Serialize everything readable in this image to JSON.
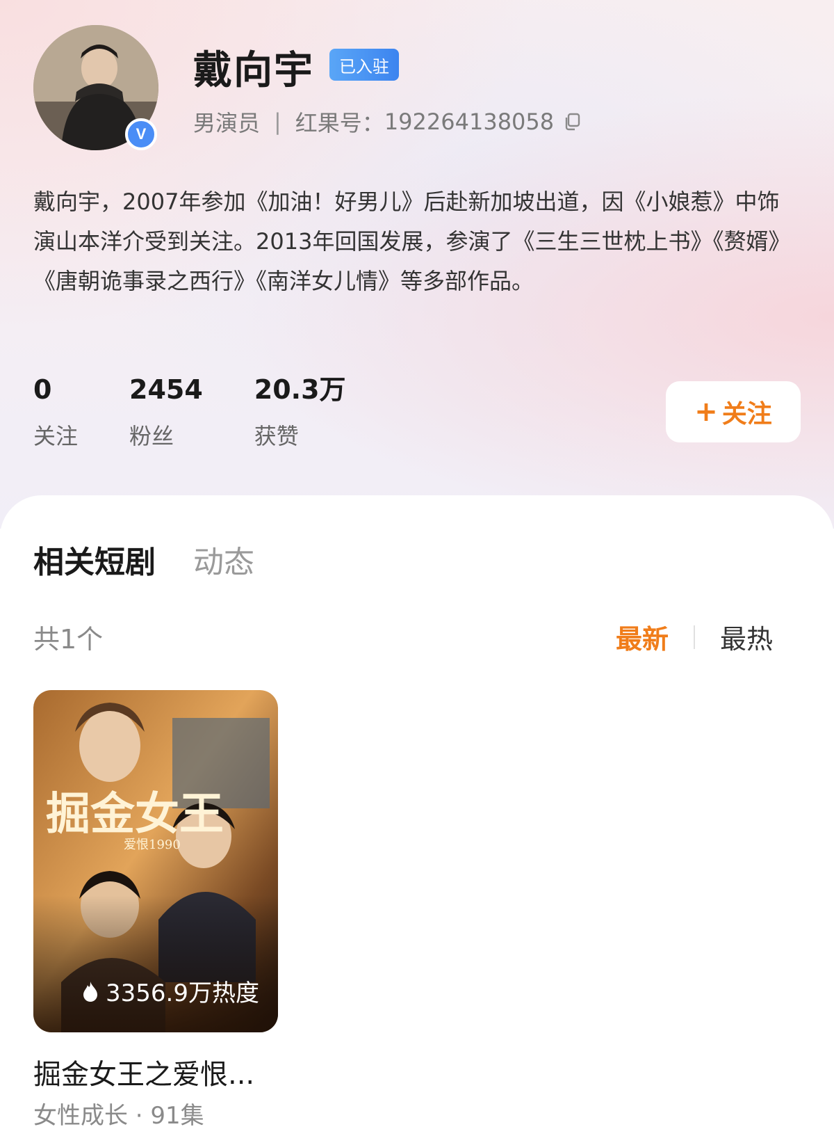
{
  "profile": {
    "name": "戴向宇",
    "settled_badge": "已入驻",
    "role": "男演员",
    "separator": "|",
    "hongguo_id_label": "红果号：",
    "hongguo_id": "192264138058",
    "verified_mark": "V",
    "bio": "戴向宇，2007年参加《加油！好男儿》后赴新加坡出道，因《小娘惹》中饰演山本洋介受到关注。2013年回国发展，参演了《三生三世枕上书》《赘婿》《唐朝诡事录之西行》《南洋女儿情》等多部作品。"
  },
  "stats": [
    {
      "value": "0",
      "label": "关注"
    },
    {
      "value": "2454",
      "label": "粉丝"
    },
    {
      "value": "20.3万",
      "label": "获赞"
    }
  ],
  "follow_button": {
    "plus": "+",
    "label": "关注"
  },
  "tabs": [
    {
      "label": "相关短剧",
      "active": true
    },
    {
      "label": "动态",
      "active": false
    }
  ],
  "list": {
    "count_label": "共1个",
    "sort_newest": "最新",
    "sort_hottest": "最热"
  },
  "dramas": [
    {
      "poster_title": "掘金女王",
      "poster_subtitle": "爱恨1990",
      "heat": "3356.9万热度",
      "title": "掘金女王之爱恨...",
      "meta": "女性成长 · 91集"
    }
  ],
  "colors": {
    "accent": "#f07d1a",
    "verified_blue": "#4a8df6",
    "settled_blue": "#3c84ef"
  }
}
